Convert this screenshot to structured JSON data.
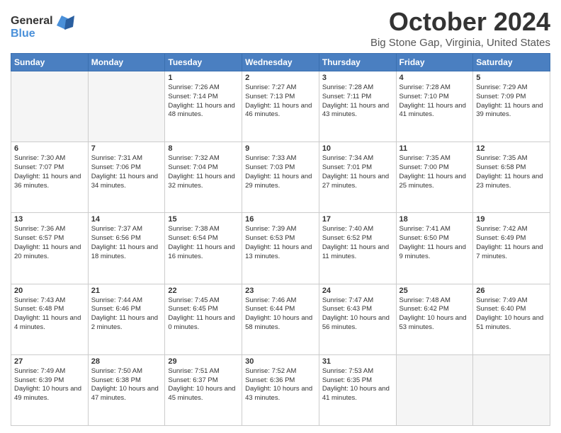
{
  "logo": {
    "line1": "General",
    "line2": "Blue"
  },
  "title": "October 2024",
  "location": "Big Stone Gap, Virginia, United States",
  "days": [
    "Sunday",
    "Monday",
    "Tuesday",
    "Wednesday",
    "Thursday",
    "Friday",
    "Saturday"
  ],
  "weeks": [
    [
      {
        "num": "",
        "text": ""
      },
      {
        "num": "",
        "text": ""
      },
      {
        "num": "1",
        "text": "Sunrise: 7:26 AM\nSunset: 7:14 PM\nDaylight: 11 hours and 48 minutes."
      },
      {
        "num": "2",
        "text": "Sunrise: 7:27 AM\nSunset: 7:13 PM\nDaylight: 11 hours and 46 minutes."
      },
      {
        "num": "3",
        "text": "Sunrise: 7:28 AM\nSunset: 7:11 PM\nDaylight: 11 hours and 43 minutes."
      },
      {
        "num": "4",
        "text": "Sunrise: 7:28 AM\nSunset: 7:10 PM\nDaylight: 11 hours and 41 minutes."
      },
      {
        "num": "5",
        "text": "Sunrise: 7:29 AM\nSunset: 7:09 PM\nDaylight: 11 hours and 39 minutes."
      }
    ],
    [
      {
        "num": "6",
        "text": "Sunrise: 7:30 AM\nSunset: 7:07 PM\nDaylight: 11 hours and 36 minutes."
      },
      {
        "num": "7",
        "text": "Sunrise: 7:31 AM\nSunset: 7:06 PM\nDaylight: 11 hours and 34 minutes."
      },
      {
        "num": "8",
        "text": "Sunrise: 7:32 AM\nSunset: 7:04 PM\nDaylight: 11 hours and 32 minutes."
      },
      {
        "num": "9",
        "text": "Sunrise: 7:33 AM\nSunset: 7:03 PM\nDaylight: 11 hours and 29 minutes."
      },
      {
        "num": "10",
        "text": "Sunrise: 7:34 AM\nSunset: 7:01 PM\nDaylight: 11 hours and 27 minutes."
      },
      {
        "num": "11",
        "text": "Sunrise: 7:35 AM\nSunset: 7:00 PM\nDaylight: 11 hours and 25 minutes."
      },
      {
        "num": "12",
        "text": "Sunrise: 7:35 AM\nSunset: 6:58 PM\nDaylight: 11 hours and 23 minutes."
      }
    ],
    [
      {
        "num": "13",
        "text": "Sunrise: 7:36 AM\nSunset: 6:57 PM\nDaylight: 11 hours and 20 minutes."
      },
      {
        "num": "14",
        "text": "Sunrise: 7:37 AM\nSunset: 6:56 PM\nDaylight: 11 hours and 18 minutes."
      },
      {
        "num": "15",
        "text": "Sunrise: 7:38 AM\nSunset: 6:54 PM\nDaylight: 11 hours and 16 minutes."
      },
      {
        "num": "16",
        "text": "Sunrise: 7:39 AM\nSunset: 6:53 PM\nDaylight: 11 hours and 13 minutes."
      },
      {
        "num": "17",
        "text": "Sunrise: 7:40 AM\nSunset: 6:52 PM\nDaylight: 11 hours and 11 minutes."
      },
      {
        "num": "18",
        "text": "Sunrise: 7:41 AM\nSunset: 6:50 PM\nDaylight: 11 hours and 9 minutes."
      },
      {
        "num": "19",
        "text": "Sunrise: 7:42 AM\nSunset: 6:49 PM\nDaylight: 11 hours and 7 minutes."
      }
    ],
    [
      {
        "num": "20",
        "text": "Sunrise: 7:43 AM\nSunset: 6:48 PM\nDaylight: 11 hours and 4 minutes."
      },
      {
        "num": "21",
        "text": "Sunrise: 7:44 AM\nSunset: 6:46 PM\nDaylight: 11 hours and 2 minutes."
      },
      {
        "num": "22",
        "text": "Sunrise: 7:45 AM\nSunset: 6:45 PM\nDaylight: 11 hours and 0 minutes."
      },
      {
        "num": "23",
        "text": "Sunrise: 7:46 AM\nSunset: 6:44 PM\nDaylight: 10 hours and 58 minutes."
      },
      {
        "num": "24",
        "text": "Sunrise: 7:47 AM\nSunset: 6:43 PM\nDaylight: 10 hours and 56 minutes."
      },
      {
        "num": "25",
        "text": "Sunrise: 7:48 AM\nSunset: 6:42 PM\nDaylight: 10 hours and 53 minutes."
      },
      {
        "num": "26",
        "text": "Sunrise: 7:49 AM\nSunset: 6:40 PM\nDaylight: 10 hours and 51 minutes."
      }
    ],
    [
      {
        "num": "27",
        "text": "Sunrise: 7:49 AM\nSunset: 6:39 PM\nDaylight: 10 hours and 49 minutes."
      },
      {
        "num": "28",
        "text": "Sunrise: 7:50 AM\nSunset: 6:38 PM\nDaylight: 10 hours and 47 minutes."
      },
      {
        "num": "29",
        "text": "Sunrise: 7:51 AM\nSunset: 6:37 PM\nDaylight: 10 hours and 45 minutes."
      },
      {
        "num": "30",
        "text": "Sunrise: 7:52 AM\nSunset: 6:36 PM\nDaylight: 10 hours and 43 minutes."
      },
      {
        "num": "31",
        "text": "Sunrise: 7:53 AM\nSunset: 6:35 PM\nDaylight: 10 hours and 41 minutes."
      },
      {
        "num": "",
        "text": ""
      },
      {
        "num": "",
        "text": ""
      }
    ]
  ]
}
